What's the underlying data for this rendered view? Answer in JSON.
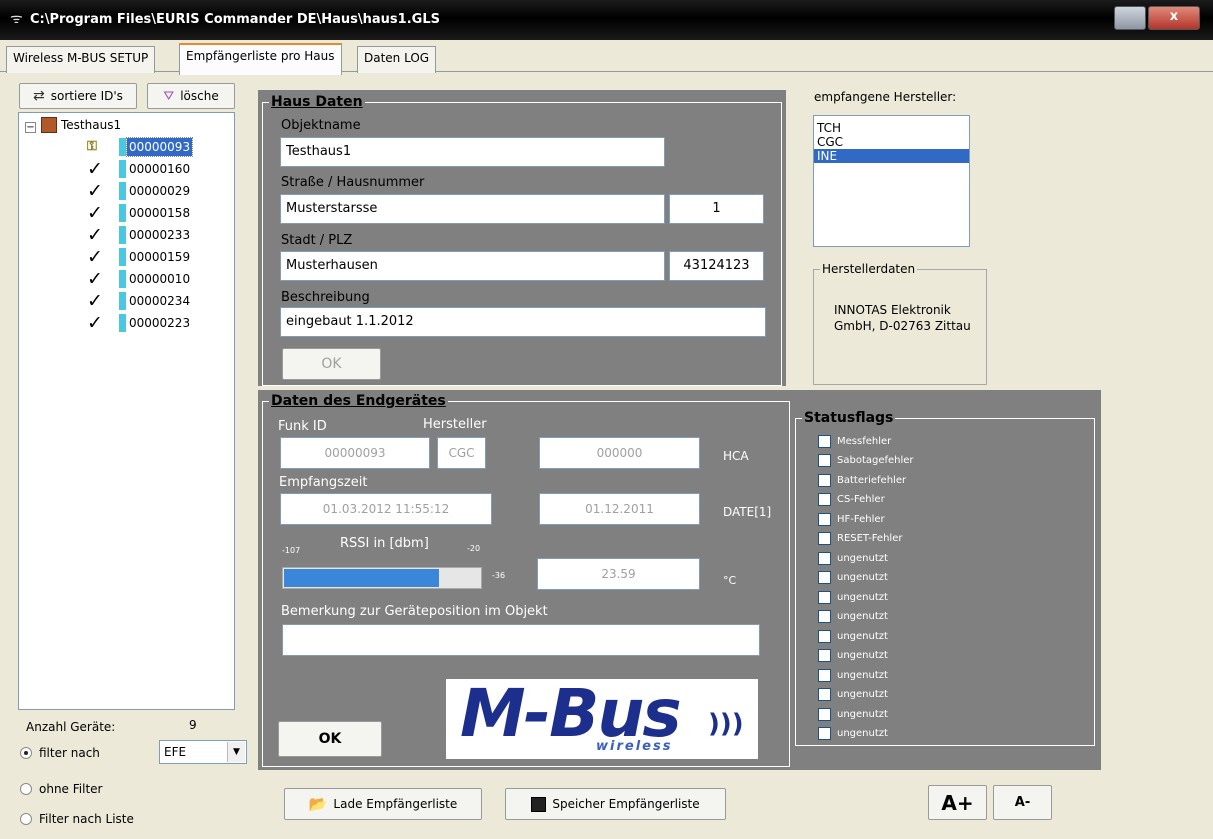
{
  "window": {
    "title": "C:\\Program Files\\EURIS Commander DE\\Haus\\haus1.GLS",
    "close_label": "x"
  },
  "tabs": [
    {
      "label": "Wireless M-BUS SETUP"
    },
    {
      "label": "Empfängerliste pro Haus"
    },
    {
      "label": "Daten LOG"
    }
  ],
  "toolbar": {
    "sort_label": "sortiere ID's",
    "delete_label": "lösche"
  },
  "tree": {
    "root": "Testhaus1",
    "nodes": [
      "00000093",
      "00000160",
      "00000029",
      "00000158",
      "00000233",
      "00000159",
      "00000010",
      "00000234",
      "00000223"
    ],
    "selected_index": 0
  },
  "count": {
    "label": "Anzahl Geräte:",
    "value": "9"
  },
  "filters": {
    "filter_nach": "filter nach",
    "select_value": "EFE",
    "ohne_filter": "ohne Filter",
    "filter_liste": "Filter nach Liste"
  },
  "haus": {
    "legend": "Haus Daten",
    "objektname_label": "Objektname",
    "objektname": "Testhaus1",
    "strasse_label": "Straße / Hausnummer",
    "strasse": "Musterstarsse",
    "hausnummer": "1",
    "stadt_label": "Stadt / PLZ",
    "stadt": "Musterhausen",
    "plz": "43124123",
    "beschreibung_label": "Beschreibung",
    "beschreibung": "eingebaut 1.1.2012",
    "ok_label": "OK"
  },
  "hersteller": {
    "list_label": "empfangene Hersteller:",
    "items": [
      "TCH",
      "CGC",
      "INE"
    ],
    "selected_index": 2,
    "details_legend": "Herstellerdaten",
    "details_text": "INNOTAS Elektronik GmbH, D-02763 Zittau"
  },
  "device": {
    "legend": "Daten des Endgerätes",
    "funk_id_label": "Funk ID",
    "hersteller_label": "Hersteller",
    "funk_id": "00000093",
    "hersteller": "CGC",
    "hca_value": "000000",
    "hca_label": "HCA",
    "empfangszeit_label": "Empfangszeit",
    "empfangszeit": "01.03.2012 11:55:12",
    "date_value": "01.12.2011",
    "date_label": "DATE[1]",
    "rssi_label": "RSSI in [dbm]",
    "rssi_min": "-107",
    "rssi_max": "-20",
    "rssi_value": "-36",
    "rssi_fill": 0.816,
    "temp_value": "23.59",
    "temp_unit": "°C",
    "bemerkung_label": "Bemerkung zur Geräteposition im Objekt",
    "bemerkung": "",
    "ok_label": "OK"
  },
  "logo": {
    "text": "M-Bus",
    "subtext": "wireless"
  },
  "statusflags": {
    "legend": "Statusflags",
    "items": [
      "Messfehler",
      "Sabotagefehler",
      "Batteriefehler",
      "CS-Fehler",
      "HF-Fehler",
      "RESET-Fehler",
      "ungenutzt",
      "ungenutzt",
      "ungenutzt",
      "ungenutzt",
      "ungenutzt",
      "ungenutzt",
      "ungenutzt",
      "ungenutzt",
      "ungenutzt",
      "ungenutzt"
    ]
  },
  "bottom": {
    "lade_label": "Lade Empfängerliste",
    "speicher_label": "Speicher Empfängerliste",
    "font_plus": "A+",
    "font_minus": "A-"
  },
  "colors": {
    "selection": "#316ac5",
    "panel": "#808080",
    "rssi_bar": "#3a86d8",
    "logo_blue": "#1d2f8c"
  }
}
